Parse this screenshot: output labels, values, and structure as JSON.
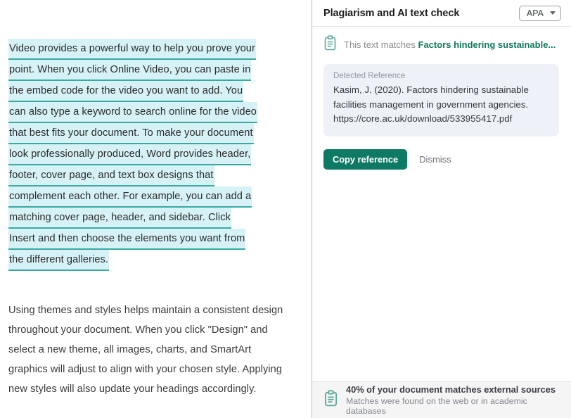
{
  "document": {
    "highlighted_paragraph": {
      "lines": [
        "Video provides a powerful way to help you prove your",
        "point. When you click Online Video, you can paste in",
        "the embed code for the video you want to add. You",
        "can also type a keyword to search online for the video",
        "that best fits your document. To make your document",
        "look professionally produced, Word provides header,",
        "footer, cover page, and text box designs that",
        "complement each other. For example, you can add a",
        "matching cover page, header, and sidebar. Click",
        "Insert and then choose the elements you want from",
        "the different galleries."
      ],
      "highlight_color": "#d6f2f7",
      "underline_color": "#3aa99f"
    },
    "plain_paragraph": "Using themes and styles helps maintain a consistent design throughout your document. When you click \"Design\" and select a new theme, all images, charts, and SmartArt graphics will adjust to align with your chosen style. Applying new styles will also update your headings accordingly."
  },
  "panel": {
    "title": "Plagiarism and AI text check",
    "style_select": {
      "value": "APA",
      "icon": "chevron-down-icon"
    },
    "match": {
      "icon": "clipboard-icon",
      "prefix": "This text matches",
      "source_title": "Factors hindering sustainable...",
      "accent_color": "#117a5e"
    },
    "reference_card": {
      "label": "Detected Reference",
      "lines": [
        "Kasim, J. (2020). Factors hindering sustainable",
        "facilities management in government agencies.",
        "https://core.ac.uk/download/533955417.pdf"
      ],
      "background": "#eef1f8"
    },
    "actions": {
      "copy_label": "Copy reference",
      "copy_color": "#0f7a63",
      "dismiss_label": "Dismiss"
    },
    "footer": {
      "icon": "clipboard-icon",
      "title": "40% of your document matches external sources",
      "subtitle": "Matches were found on the web or in academic databases",
      "match_percent": "40%"
    }
  }
}
